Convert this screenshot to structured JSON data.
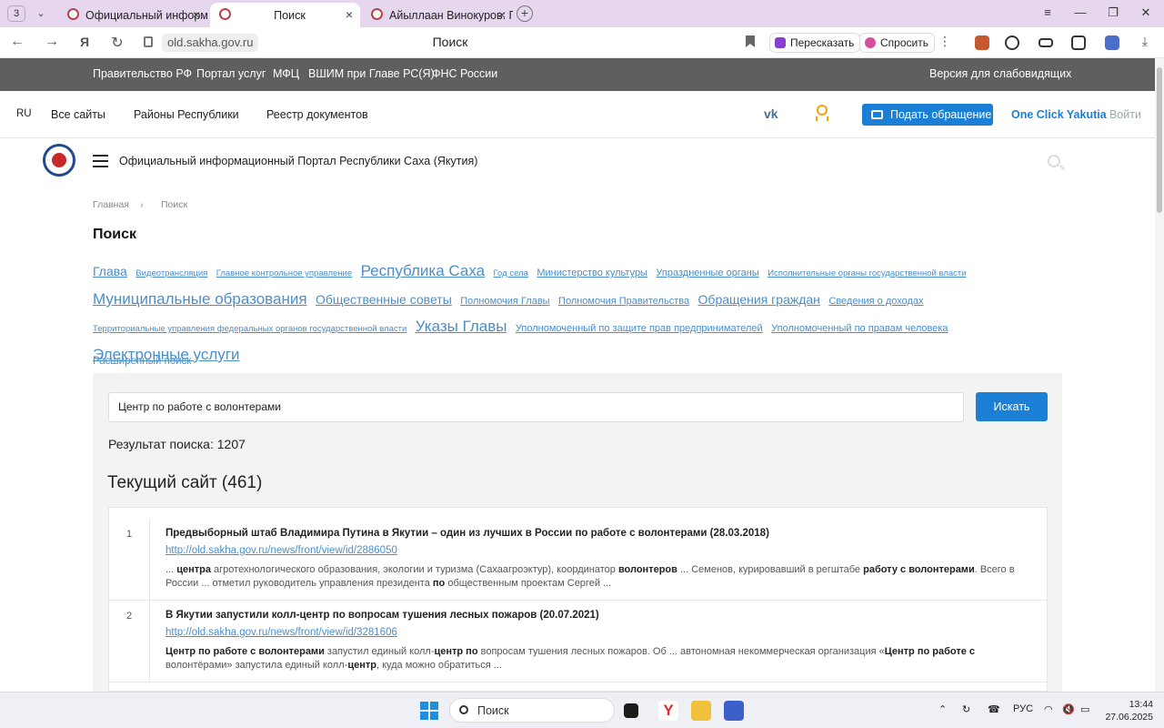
{
  "browser": {
    "tab_count": "3",
    "tabs": [
      {
        "title": "Официальный информац"
      },
      {
        "title": "Поиск"
      },
      {
        "title": "Айыллаан Винокуров: Пр"
      }
    ],
    "url": "old.sakha.gov.ru",
    "page_title": "Поиск",
    "retell_label": "Пересказать",
    "ask_label": "Спросить",
    "win_min": "—",
    "win_max": "❐",
    "win_close": "✕"
  },
  "gov_bar": {
    "links": [
      "Правительство РФ",
      "Портал услуг",
      "МФЦ",
      "ВШИМ при Главе РС(Я)",
      "ФНС России"
    ],
    "accessibility": "Версия для слабовидящих"
  },
  "header": {
    "lang": "RU",
    "links": [
      "Все сайты",
      "Районы Республики",
      "Реестр документов"
    ],
    "vk": "vk",
    "appeal_label": "Подать обращение",
    "one_click": "One Click Yakutia",
    "login": "Войти"
  },
  "brand": {
    "portal_title": "Официальный информационный Портал Республики Саха (Якутия)"
  },
  "breadcrumb": {
    "home": "Главная",
    "sep": "›",
    "current": "Поиск"
  },
  "page": {
    "title": "Поиск"
  },
  "tags": [
    {
      "label": "Глава",
      "size": 3
    },
    {
      "label": "Видеотрансляция",
      "size": 1
    },
    {
      "label": "Главное контрольное управление",
      "size": 1
    },
    {
      "label": "Республика Саха",
      "size": 4
    },
    {
      "label": "Год села",
      "size": 1
    },
    {
      "label": "Министерство культуры",
      "size": 2
    },
    {
      "label": "Упраздненные органы",
      "size": 2
    },
    {
      "label": "Исполнительные органы государственной власти",
      "size": 1
    },
    {
      "label": "Муниципальные образования",
      "size": 4
    },
    {
      "label": "Общественные советы",
      "size": 3
    },
    {
      "label": "Полномочия Главы",
      "size": 2
    },
    {
      "label": "Полномочия Правительства",
      "size": 2
    },
    {
      "label": "Обращения граждан",
      "size": 3
    },
    {
      "label": "Сведения о доходах",
      "size": 2
    },
    {
      "label": "Территориальные управления федеральных органов государственной власти",
      "size": 1
    },
    {
      "label": "Указы Главы",
      "size": 4
    },
    {
      "label": "Уполномоченный по защите прав предпринимателей",
      "size": 2
    },
    {
      "label": "Уполномоченный по правам человека",
      "size": 2
    },
    {
      "label": "Электронные услуги",
      "size": 4
    }
  ],
  "search": {
    "advanced_label": "Расширенный поиск",
    "query": "Центр по работе с волонтерами",
    "button_label": "Искать",
    "result_count": "Результат поиска: 1207",
    "current_site": "Текущий сайт (461)"
  },
  "results": [
    {
      "num": "1",
      "title": "Предвыборный штаб Владимира Путина в Якутии – один из лучших в России по работе с волонтерами (28.03.2018)",
      "url": "http://old.sakha.gov.ru/news/front/view/id/2886050",
      "snippet": [
        {
          "t": "... ",
          "b": false
        },
        {
          "t": "центра",
          "b": true
        },
        {
          "t": " агротехнологического образования, экологии и туризма (Сахаагроэктур), координатор ",
          "b": false
        },
        {
          "t": "волонтеров",
          "b": true
        },
        {
          "t": " ... Семенов, курировавший в регштабе ",
          "b": false
        },
        {
          "t": "работу с волонтерами",
          "b": true
        },
        {
          "t": ". Всего в России ... отметил руководитель управления президента ",
          "b": false
        },
        {
          "t": "по",
          "b": true
        },
        {
          "t": " общественным проектам Сергей ...",
          "b": false
        }
      ]
    },
    {
      "num": "2",
      "title": "В Якутии запустили колл-центр по вопросам тушения лесных пожаров (20.07.2021)",
      "url": "http://old.sakha.gov.ru/news/front/view/id/3281606",
      "snippet": [
        {
          "t": "Центр по работе с волонтерами",
          "b": true
        },
        {
          "t": " запустил единый колл-",
          "b": false
        },
        {
          "t": "центр по",
          "b": true
        },
        {
          "t": " вопросам тушения лесных пожаров. Об ... автономная некоммерческая организация «",
          "b": false
        },
        {
          "t": "Центр по работе с",
          "b": true
        },
        {
          "t": " волонтёрами» запустила единый колл-",
          "b": false
        },
        {
          "t": "центр",
          "b": true
        },
        {
          "t": ", куда можно обратиться ...",
          "b": false
        }
      ]
    }
  ],
  "taskbar": {
    "search_label": "Поиск",
    "lang": "РУС",
    "time": "13:44",
    "date": "27.06.2025"
  }
}
